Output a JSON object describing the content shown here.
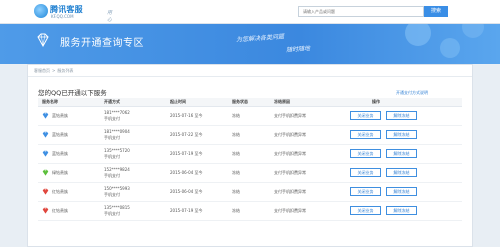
{
  "header": {
    "logo_text": "腾讯客服",
    "logo_url": "KF.QQ.COM",
    "logo_tagline": "用心服务",
    "search_placeholder": "请输入产品或问题",
    "search_button": "搜索"
  },
  "banner": {
    "title": "服务开通查询专区",
    "slogan_line1": "为您解决各类问题",
    "slogan_line2": "随时随地"
  },
  "breadcrumb": [
    "客服首页",
    "服务列表"
  ],
  "section": {
    "title": "您的QQ已开通以下服务",
    "help_link": "开通支付方式说明"
  },
  "table": {
    "columns": [
      "服务名称",
      "开通方式",
      "起止时间",
      "服务状态",
      "冻结原因",
      "操作"
    ],
    "rows": [
      {
        "service": "蓝钻贵族",
        "icon": "blue-diamond-icon",
        "account": "181****7062",
        "method": "手机支付",
        "date": "2015-07-16 至今",
        "status": "冻结",
        "reason": "支付手机扣费异常",
        "btn1": "关闭业务",
        "btn2": "解除冻结"
      },
      {
        "service": "蓝钻贵族",
        "icon": "blue-diamond-icon",
        "account": "181****0904",
        "method": "手机支付",
        "date": "2015-07-22 至今",
        "status": "冻结",
        "reason": "支付手机扣费异常",
        "btn1": "关闭业务",
        "btn2": "解除冻结"
      },
      {
        "service": "蓝钻贵族",
        "icon": "blue-diamond-icon",
        "account": "135****5720",
        "method": "手机支付",
        "date": "2015-07-19 至今",
        "status": "冻结",
        "reason": "支付手机扣费异常",
        "btn1": "关闭业务",
        "btn2": "解除冻结"
      },
      {
        "service": "绿钻贵族",
        "icon": "green-diamond-icon",
        "account": "152****9824",
        "method": "手机支付",
        "date": "2015-06-04 至今",
        "status": "冻结",
        "reason": "支付手机扣费异常",
        "btn1": "关闭业务",
        "btn2": "解除冻结"
      },
      {
        "service": "红钻贵族",
        "icon": "red-diamond-icon",
        "account": "150****5993",
        "method": "手机支付",
        "date": "2015-06-04 至今",
        "status": "冻结",
        "reason": "支付手机扣费异常",
        "btn1": "关闭业务",
        "btn2": "解除冻结"
      },
      {
        "service": "红钻贵族",
        "icon": "red-diamond-icon",
        "account": "135****0815",
        "method": "手机支付",
        "date": "2015-07-19 至今",
        "status": "冻结",
        "reason": "支付手机扣费异常",
        "btn1": "关闭业务",
        "btn2": "解除冻结"
      }
    ]
  },
  "colors": {
    "blue_diamond": "#3d8fe3",
    "green_diamond": "#5bbf3a",
    "red_diamond": "#e0453c",
    "accent": "#3a8ee6"
  }
}
